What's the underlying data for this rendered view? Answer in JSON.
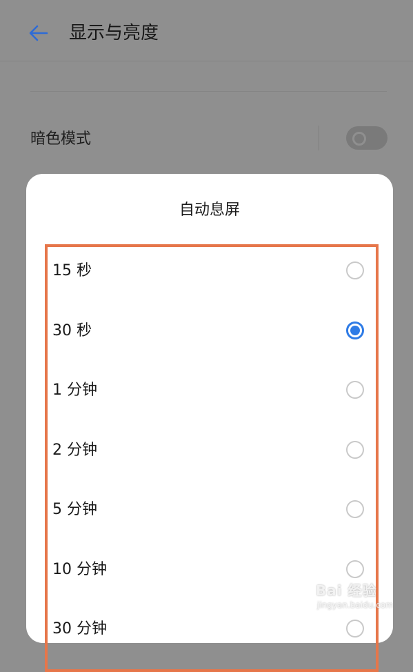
{
  "header": {
    "title": "显示与亮度",
    "back_icon": "arrow-left-icon",
    "accent_color": "#2e6bd6"
  },
  "settings": {
    "dark_mode_label": "暗色模式",
    "dark_mode_enabled": false
  },
  "dialog": {
    "title": "自动息屏",
    "selected_index": 1,
    "options": [
      {
        "label": "15 秒",
        "checked": false
      },
      {
        "label": "30 秒",
        "checked": true
      },
      {
        "label": "1 分钟",
        "checked": false
      },
      {
        "label": "2 分钟",
        "checked": false
      },
      {
        "label": "5 分钟",
        "checked": false
      },
      {
        "label": "10 分钟",
        "checked": false
      },
      {
        "label": "30 分钟",
        "checked": false
      }
    ],
    "radio_color": "#2e7be6",
    "highlight_color": "#e6764a"
  },
  "watermark": {
    "brand": "Bai 经验",
    "url": "jingyan.baidu.com"
  }
}
